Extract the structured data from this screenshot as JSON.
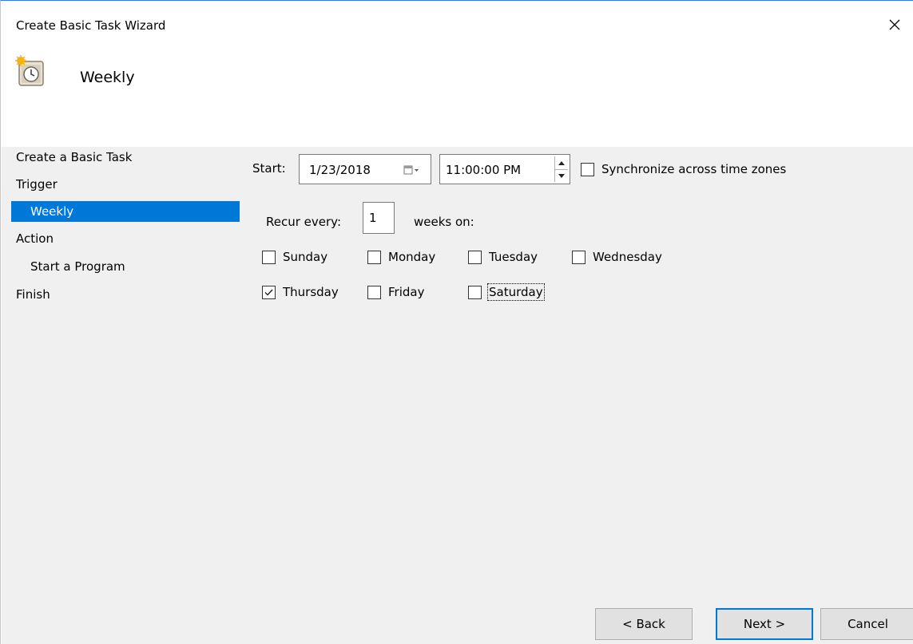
{
  "window": {
    "title": "Create Basic Task Wizard"
  },
  "header": {
    "title": "Weekly",
    "icon": "scheduled-task-clock-icon"
  },
  "nav": {
    "items": [
      {
        "label": "Create a Basic Task",
        "level": 0,
        "selected": false
      },
      {
        "label": "Trigger",
        "level": 0,
        "selected": false
      },
      {
        "label": "Weekly",
        "level": 1,
        "selected": true
      },
      {
        "label": "Action",
        "level": 0,
        "selected": false
      },
      {
        "label": "Start a Program",
        "level": 1,
        "selected": false
      },
      {
        "label": "Finish",
        "level": 0,
        "selected": false
      }
    ]
  },
  "start": {
    "label": "Start:",
    "date": "1/23/2018",
    "time": "11:00:00 PM",
    "sync_label": "Synchronize across time zones",
    "sync_checked": false
  },
  "recur": {
    "label": "Recur every:",
    "value": "1",
    "suffix": "weeks on:"
  },
  "days": [
    {
      "label": "Sunday",
      "checked": false
    },
    {
      "label": "Monday",
      "checked": false
    },
    {
      "label": "Tuesday",
      "checked": false
    },
    {
      "label": "Wednesday",
      "checked": false
    },
    {
      "label": "Thursday",
      "checked": true
    },
    {
      "label": "Friday",
      "checked": false
    },
    {
      "label": "Saturday",
      "checked": false,
      "focused": true
    }
  ],
  "buttons": {
    "back": "< Back",
    "next": "Next >",
    "cancel": "Cancel"
  },
  "colors": {
    "accent": "#0078d7",
    "panel": "#f0f0f0"
  }
}
